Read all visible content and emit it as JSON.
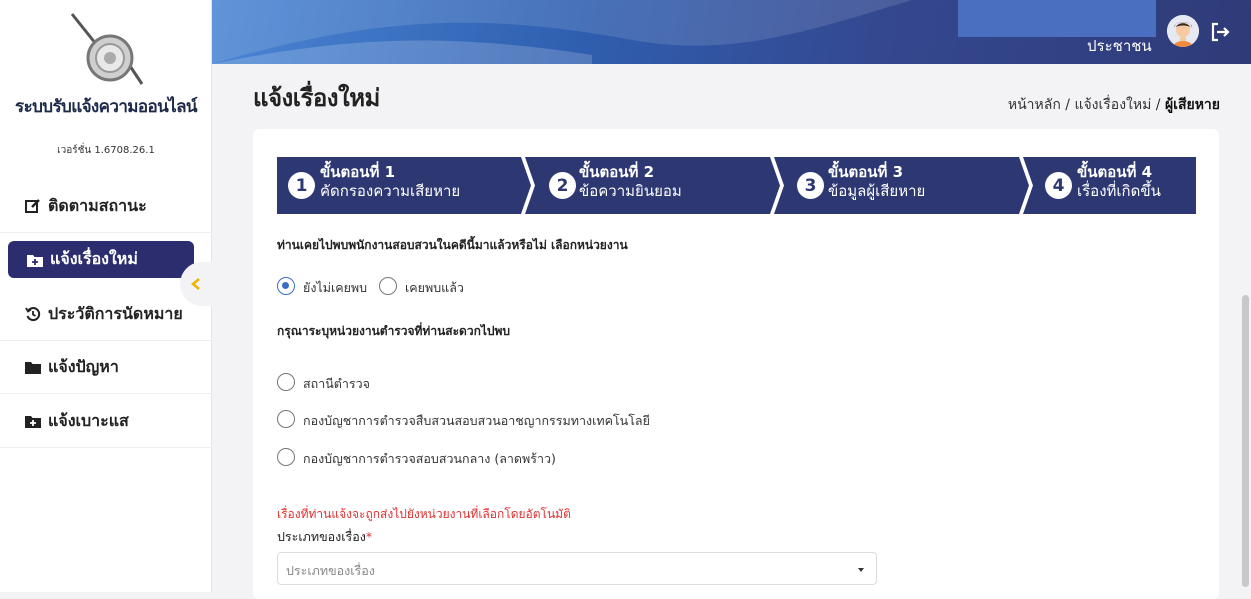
{
  "app": {
    "title": "ระบบรับแจ้งความออนไลน์",
    "version": "เวอร์ชั่น 1.6708.26.1"
  },
  "sidebar": {
    "items": [
      {
        "label": "ติดตามสถานะ",
        "icon": "edit-icon"
      },
      {
        "label": "แจ้งเรื่องใหม่",
        "icon": "folder-plus-icon",
        "active": true
      },
      {
        "label": "ประวัติการนัดหมาย",
        "icon": "history-icon"
      },
      {
        "label": "แจ้งปัญหา",
        "icon": "folder-icon"
      },
      {
        "label": "แจ้งเบาะแส",
        "icon": "folder-plus-icon"
      }
    ]
  },
  "header": {
    "user_name": "ประชาชน"
  },
  "page": {
    "title": "แจ้งเรื่องใหม่",
    "breadcrumb": {
      "home": "หน้าหลัก",
      "sep": " / ",
      "section": "แจ้งเรื่องใหม่",
      "current": "ผู้เสียหาย"
    }
  },
  "steps": [
    {
      "num": "1",
      "title": "ขั้นตอนที่ 1",
      "subtitle": "คัดกรองความเสียหาย"
    },
    {
      "num": "2",
      "title": "ขั้นตอนที่ 2",
      "subtitle": "ข้อความยินยอม"
    },
    {
      "num": "3",
      "title": "ขั้นตอนที่ 3",
      "subtitle": "ข้อมูลผู้เสียหาย"
    },
    {
      "num": "4",
      "title": "ขั้นตอนที่ 4",
      "subtitle": "เรื่องที่เกิดขึ้น"
    }
  ],
  "form": {
    "q1": "ท่านเคยไปพบพนักงานสอบสวนในคดีนี้มาแล้วหรือไม่ เลือกหน่วยงาน",
    "q1_options": [
      {
        "label": "ยังไม่เคยพบ",
        "selected": true
      },
      {
        "label": "เคยพบแล้ว",
        "selected": false
      }
    ],
    "q2": "กรุณาระบุหน่วยงานตำรวจที่ท่านสะดวกไปพบ",
    "q2_options": [
      {
        "label": "สถานีตำรวจ",
        "selected": false
      },
      {
        "label": "กองบัญชาการตำรวจสืบสวนสอบสวนอาชญากรรมทางเทคโนโลยี",
        "selected": false
      },
      {
        "label": "กองบัญชาการตำรวจสอบสวนกลาง (ลาดพร้าว)",
        "selected": false
      }
    ],
    "note": "เรื่องที่ท่านแจ้งจะถูกส่งไปยังหน่วยงานที่เลือกโดยอัตโนมัติ",
    "case_type_label": "ประเภทของเรื่อง",
    "required_mark": "*",
    "case_type_placeholder": "ประเภทของเรื่อง"
  },
  "colors": {
    "primary": "#2b2d6e",
    "step_bg": "#2d3772",
    "radio_selected": "#3a6fc0",
    "required": "#e03030"
  }
}
